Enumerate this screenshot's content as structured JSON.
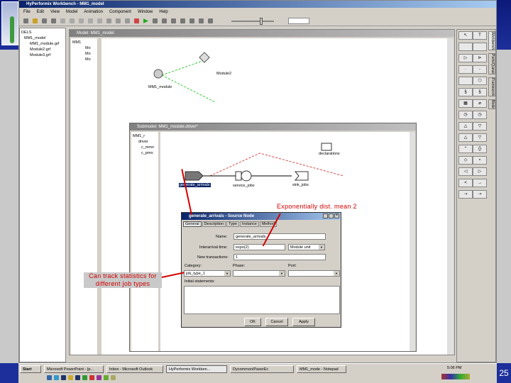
{
  "window": {
    "title": "HyPerformix Workbench - MM1_model",
    "menu": [
      "File",
      "Edit",
      "View",
      "Model",
      "Animation",
      "Component",
      "Window",
      "Help"
    ]
  },
  "left_tree": {
    "root": "DELS",
    "items": [
      "MM1_model",
      "MM1_module.grf",
      "Module2.grf",
      "Module3.grf"
    ]
  },
  "model_window": {
    "title": "Model: MM1_model",
    "tree": [
      "MM1",
      "Mo",
      "Mo",
      "Mo"
    ],
    "nodes": [
      "MM1_module",
      "Module2"
    ]
  },
  "palette": {
    "tabs": [
      "Workbench",
      "Parts/Queue",
      "Framework",
      "Node"
    ]
  },
  "submodel": {
    "title": "Submodel: MM1_module.driver*",
    "tree": [
      "MM1_r",
      "driver",
      "c_mmn",
      "c_pmo"
    ],
    "nodes": {
      "source": "generate_arrivals",
      "service": "service_jobs",
      "sink": "sink_jobs",
      "declarations": "declarations"
    }
  },
  "dialog": {
    "title": "generate_arrivals - Source Node",
    "tabs": [
      "General",
      "Description",
      "Type",
      "Instance",
      "Method"
    ],
    "name_label": "Name:",
    "name_value": "generate_arrivals",
    "interarrival_label": "Interarrival time:",
    "interarrival_value": "expo(2)",
    "unit_value": "Module unit",
    "new_trans_label": "New transactions:",
    "new_trans_value": "1",
    "category_label": "Category:",
    "category_value": "job_type_1",
    "phase_label": "Phase:",
    "port_label": "Port:",
    "initial_label": "Initial statements:",
    "ok": "OK",
    "cancel": "Cancel",
    "apply": "Apply"
  },
  "annotations": {
    "expo": "Exponentially dist. mean 2",
    "stats_line1": "Can track statistics for",
    "stats_line2": "different job types"
  },
  "taskbar": {
    "start": "Start",
    "tasks": [
      "Microsoft PowerPoint - [p...",
      "Inbox - Microsoft Outlook",
      "HyPerformix Workben...",
      "Dycommon/PaserEc",
      "MM1_mode - Notepad"
    ],
    "clock": "5:06 PM"
  },
  "slide_number": "25"
}
